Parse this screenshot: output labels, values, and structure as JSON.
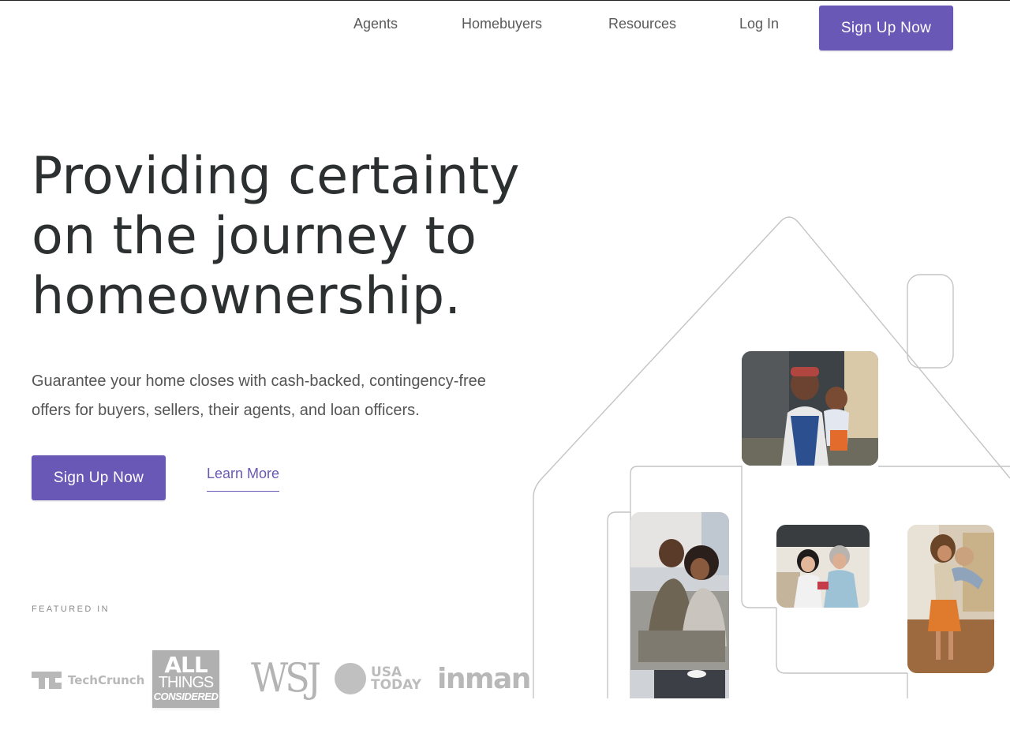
{
  "nav": {
    "links": [
      "Agents",
      "Homebuyers",
      "Resources",
      "Log In"
    ],
    "cta": "Sign Up Now"
  },
  "hero": {
    "title_lines": [
      "Providing certainty",
      "on the journey to",
      "homeownership."
    ],
    "subtitle_lines": [
      "Guarantee your home closes with cash-backed, contingency-free",
      "offers for buyers, sellers, their agents, and loan officers."
    ],
    "cta": "Sign Up Now",
    "learn_more": "Learn More"
  },
  "featured": {
    "label": "FEATURED IN",
    "logos": {
      "techcrunch": "TechCrunch",
      "all_things_considered": [
        "ALL",
        "THINGS",
        "CONSIDERED"
      ],
      "wsj": "WSJ",
      "usa_today": [
        "USA",
        "TODAY"
      ],
      "inman": "inman"
    }
  },
  "colors": {
    "brand": "#6a58b6",
    "heading": "#2d3030",
    "body_text": "#555555",
    "logo_gray": "#b8b8b8",
    "house_outline": "#c4c4c4"
  },
  "photos": [
    {
      "icon": "mother-and-baby-photo"
    },
    {
      "icon": "couple-on-couch-photo"
    },
    {
      "icon": "child-and-grandparent-photo"
    },
    {
      "icon": "family-dancing-photo"
    }
  ]
}
